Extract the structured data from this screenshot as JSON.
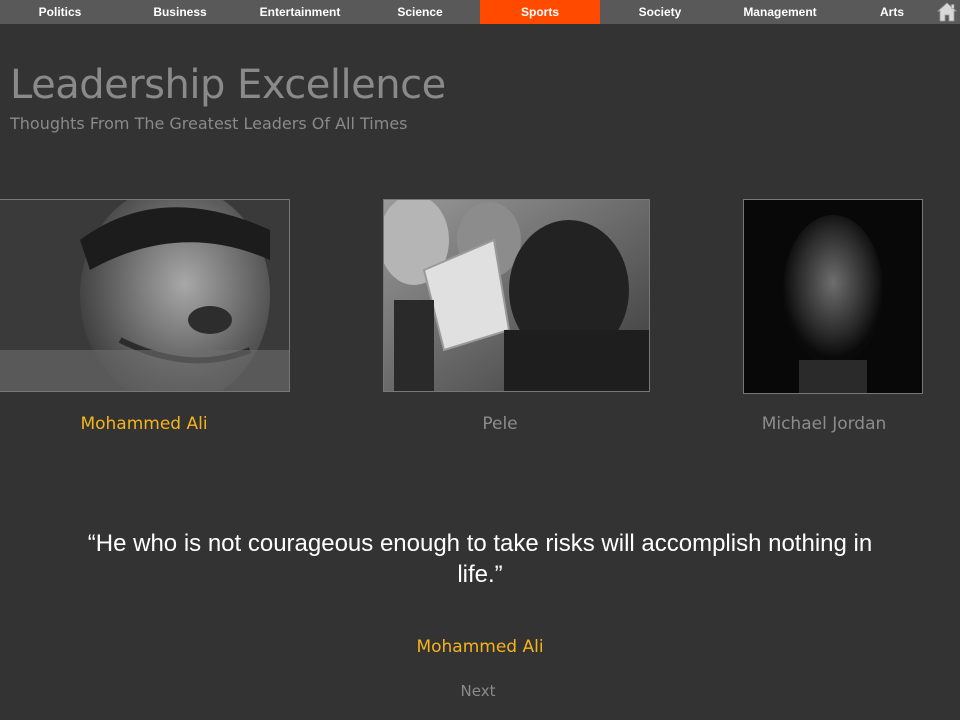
{
  "nav": {
    "items": [
      {
        "label": "Politics",
        "active": false
      },
      {
        "label": "Business",
        "active": false
      },
      {
        "label": "Entertainment",
        "active": false
      },
      {
        "label": "Science",
        "active": false
      },
      {
        "label": "Sports",
        "active": true
      },
      {
        "label": "Society",
        "active": false
      },
      {
        "label": "Management",
        "active": false
      },
      {
        "label": "Arts",
        "active": false
      }
    ],
    "home_icon": "home-icon"
  },
  "header": {
    "title": "Leadership Excellence",
    "subtitle": "Thoughts From The Greatest Leaders Of All Times"
  },
  "leaders": [
    {
      "name": "Mohammed Ali",
      "active": true
    },
    {
      "name": "Pele",
      "active": false
    },
    {
      "name": "Michael Jordan",
      "active": false
    }
  ],
  "quote": {
    "text": "“He who is not courageous enough to take risks will accomplish nothing in life.”",
    "author": "Mohammed Ali"
  },
  "next_label": "Next",
  "colors": {
    "background": "#333333",
    "nav_bar": "#595959",
    "active_tab": "#ff4a00",
    "highlight": "#f5b41c",
    "muted_text": "#8a8a8a"
  }
}
